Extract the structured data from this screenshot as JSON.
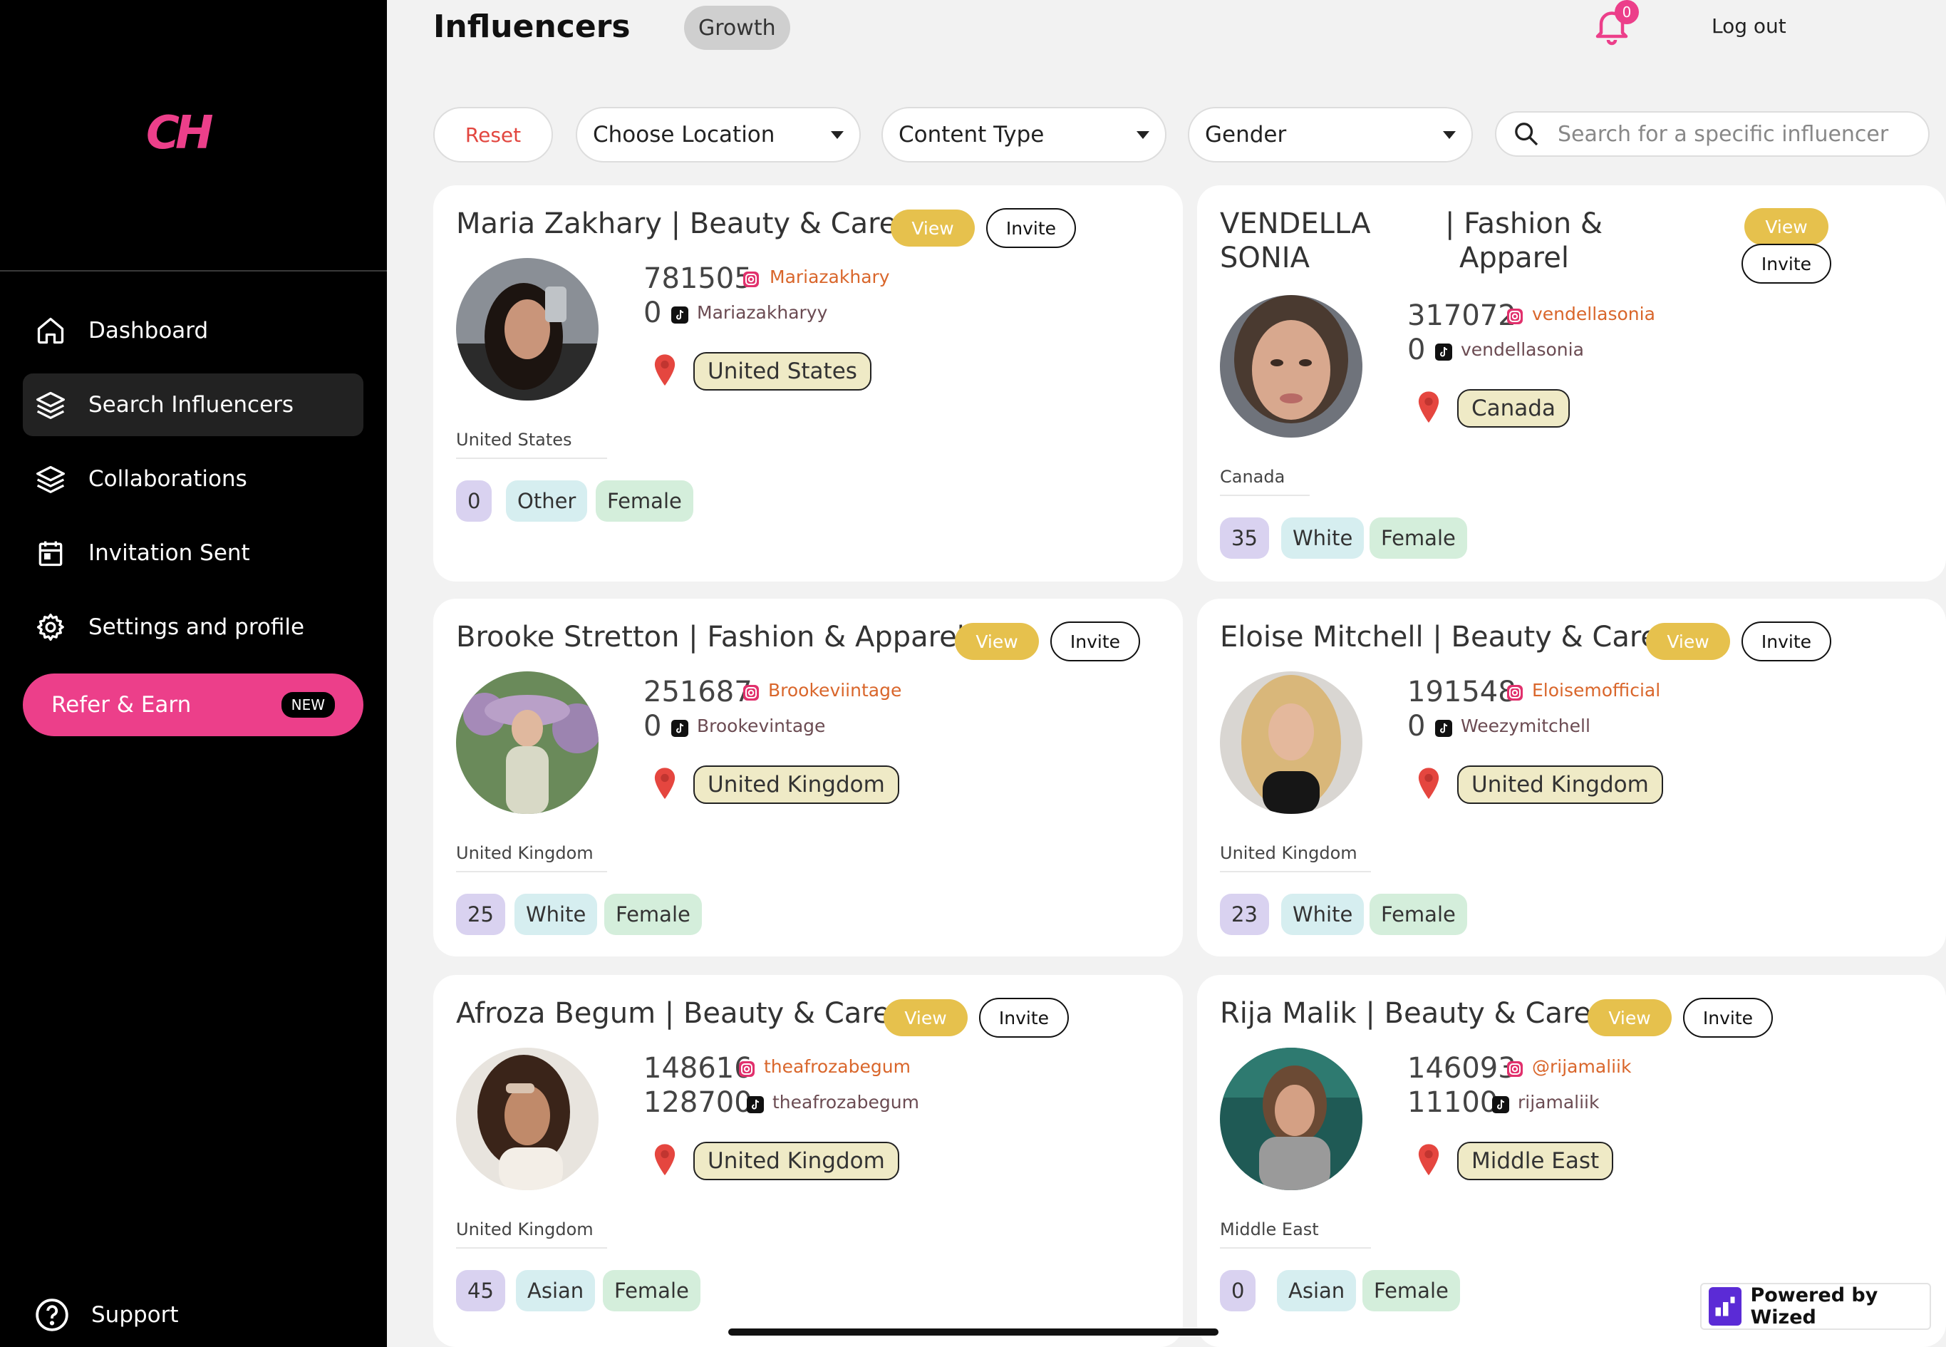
{
  "sidebar": {
    "logo_text": "CH",
    "nav": [
      {
        "label": "Dashboard",
        "icon": "home-icon"
      },
      {
        "label": "Search Influencers",
        "icon": "layers-icon",
        "active": true
      },
      {
        "label": "Collaborations",
        "icon": "layers-icon"
      },
      {
        "label": "Invitation Sent",
        "icon": "calendar-icon"
      },
      {
        "label": "Settings and profile",
        "icon": "gear-icon"
      }
    ],
    "refer": {
      "label": "Refer & Earn",
      "badge": "NEW"
    },
    "support_label": "Support"
  },
  "header": {
    "title": "Influencers",
    "plan": "Growth",
    "notification_count": "0",
    "logout_label": "Log out"
  },
  "filters": {
    "reset_label": "Reset",
    "location_label": "Choose Location",
    "content_label": "Content Type",
    "gender_label": "Gender",
    "search_placeholder": "Search for a specific influencer"
  },
  "cards": [
    {
      "name": "Maria Zakhary | Beauty & Care",
      "ig_count": "781505",
      "ig_handle": "Mariazakhary",
      "tt_count": "0",
      "tt_handle": "Mariazakharyy",
      "location_badge": "United States",
      "location_text": "United States",
      "age": "0",
      "ethnicity": "Other",
      "gender": "Female",
      "view_label": "View",
      "invite_label": "Invite"
    },
    {
      "name_line1": "VENDELLA",
      "name_line1b": "| Fashion &",
      "name_line2": "SONIA",
      "name_line2b": "Apparel",
      "ig_count": "317072",
      "ig_handle": "vendellasonia",
      "tt_count": "0",
      "tt_handle": "vendellasonia",
      "location_badge": "Canada",
      "location_text": "Canada",
      "age": "35",
      "ethnicity": "White",
      "gender": "Female",
      "view_label": "View",
      "invite_label": "Invite"
    },
    {
      "name": "Brooke Stretton | Fashion & Apparel",
      "ig_count": "251687",
      "ig_handle": "Brookeviintage",
      "tt_count": "0",
      "tt_handle": "Brookevintage",
      "location_badge": "United Kingdom",
      "location_text": "United Kingdom",
      "age": "25",
      "ethnicity": "White",
      "gender": "Female",
      "view_label": "View",
      "invite_label": "Invite"
    },
    {
      "name": "Eloise Mitchell | Beauty & Care",
      "ig_count": "191548",
      "ig_handle": "Eloisemofficial",
      "tt_count": "0",
      "tt_handle": "Weezymitchell",
      "location_badge": "United Kingdom",
      "location_text": "United Kingdom",
      "age": "23",
      "ethnicity": "White",
      "gender": "Female",
      "view_label": "View",
      "invite_label": "Invite"
    },
    {
      "name": "Afroza Begum | Beauty & Care",
      "ig_count": "148616",
      "ig_handle": "theafrozabegum",
      "tt_count": "128700",
      "tt_handle": "theafrozabegum",
      "location_badge": "United Kingdom",
      "location_text": "United Kingdom",
      "age": "45",
      "ethnicity": "Asian",
      "gender": "Female",
      "view_label": "View",
      "invite_label": "Invite"
    },
    {
      "name": "Rija Malik | Beauty & Care",
      "ig_count": "146093",
      "ig_handle": "@rijamaliik",
      "tt_count": "11100",
      "tt_handle": "rijamaliik",
      "location_badge": "Middle East",
      "location_text": "Middle East",
      "age": "0",
      "ethnicity": "Asian",
      "gender": "Female",
      "view_label": "View",
      "invite_label": "Invite"
    }
  ],
  "footer": {
    "wized_label": "Powered by Wized"
  },
  "colors": {
    "accent": "#ec3f8a",
    "view": "#e6c14d",
    "sidebar": "#000000"
  }
}
